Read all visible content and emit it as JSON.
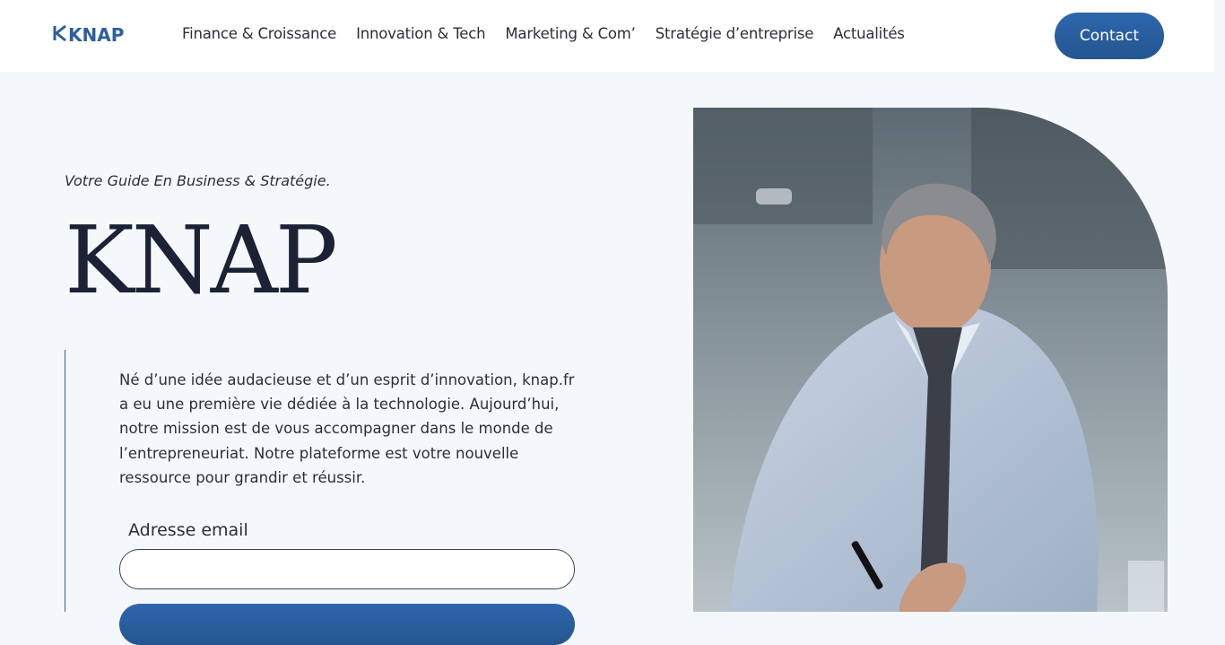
{
  "header": {
    "logo_text": "KNAP",
    "logo_mark": "K",
    "nav": [
      {
        "label": "Finance & Croissance"
      },
      {
        "label": "Innovation & Tech"
      },
      {
        "label": "Marketing & Com’"
      },
      {
        "label": "Stratégie d’entreprise"
      },
      {
        "label": "Actualités"
      }
    ],
    "contact_label": "Contact"
  },
  "hero": {
    "tagline": "Votre Guide En Business & Stratégie.",
    "title": "KNAP",
    "intro": "Né d’une idée audacieuse et d’un esprit d’innovation, knap.fr a eu une première vie dédiée à la technologie. Aujourd’hui, notre mission est de vous accompagner dans le monde de l’entrepreneuriat. Notre plateforme est votre nouvelle ressource pour grandir et réussir.",
    "email_label": "Adresse email",
    "email_value": "",
    "photo": "businessman-writing-photo"
  },
  "colors": {
    "accent": "#2c5f9e",
    "background": "#f5f8fb",
    "text": "#1b2236"
  }
}
